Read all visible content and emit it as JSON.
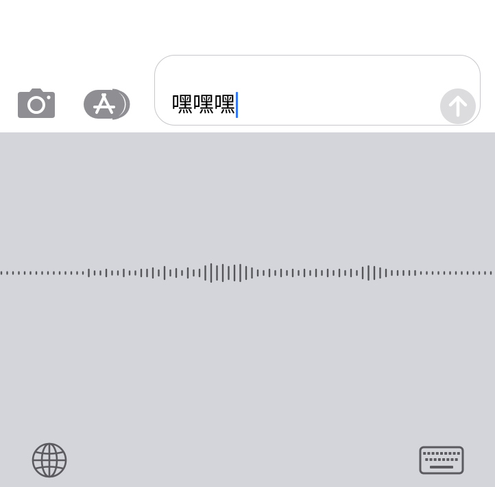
{
  "compose": {
    "text": "嘿嘿嘿"
  },
  "icons": {
    "camera": "camera-icon",
    "app_store": "app-store-icon",
    "send": "arrow-up-icon",
    "globe": "globe-icon",
    "keyboard": "keyboard-icon"
  },
  "colors": {
    "panel_background": "#d4d5db",
    "icon_gray": "#8e8e93",
    "caret": "#3478f6",
    "send_disabled": "#dcdcde",
    "waveform": "#555558"
  }
}
